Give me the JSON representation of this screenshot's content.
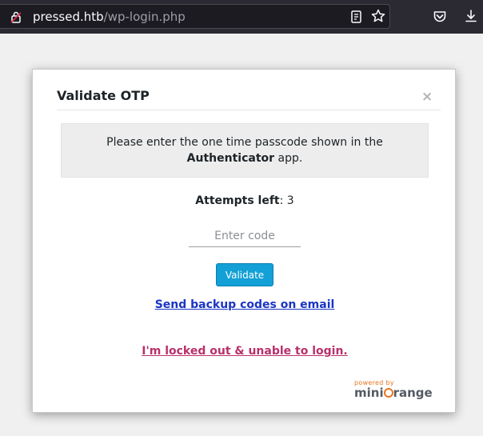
{
  "browser": {
    "url_host": "pressed.htb",
    "url_path": "/wp-login.php",
    "icons": [
      "lock-icon",
      "reader-view-icon",
      "bookmark-star-icon",
      "pocket-icon",
      "download-icon"
    ]
  },
  "modal": {
    "title": "Validate OTP",
    "close_label": "×",
    "notice_prefix": "Please enter the one time passcode shown in the ",
    "notice_app": "Authenticator",
    "notice_suffix": " app.",
    "attempts_label": "Attempts left",
    "attempts_sep": ": ",
    "attempts_value": "3",
    "otp_placeholder": "Enter code",
    "otp_value": "",
    "validate_label": "Validate",
    "backup_link": "Send backup codes on email",
    "locked_link": "I'm locked out & unable to login.",
    "powered_by": "powered by",
    "brand_pre": "mini",
    "brand_post": "range"
  },
  "colors": {
    "button": "#12a0d6",
    "backup_link": "#1a35c4",
    "locked_link": "#b9306b",
    "brand_accent": "#e8741e"
  }
}
